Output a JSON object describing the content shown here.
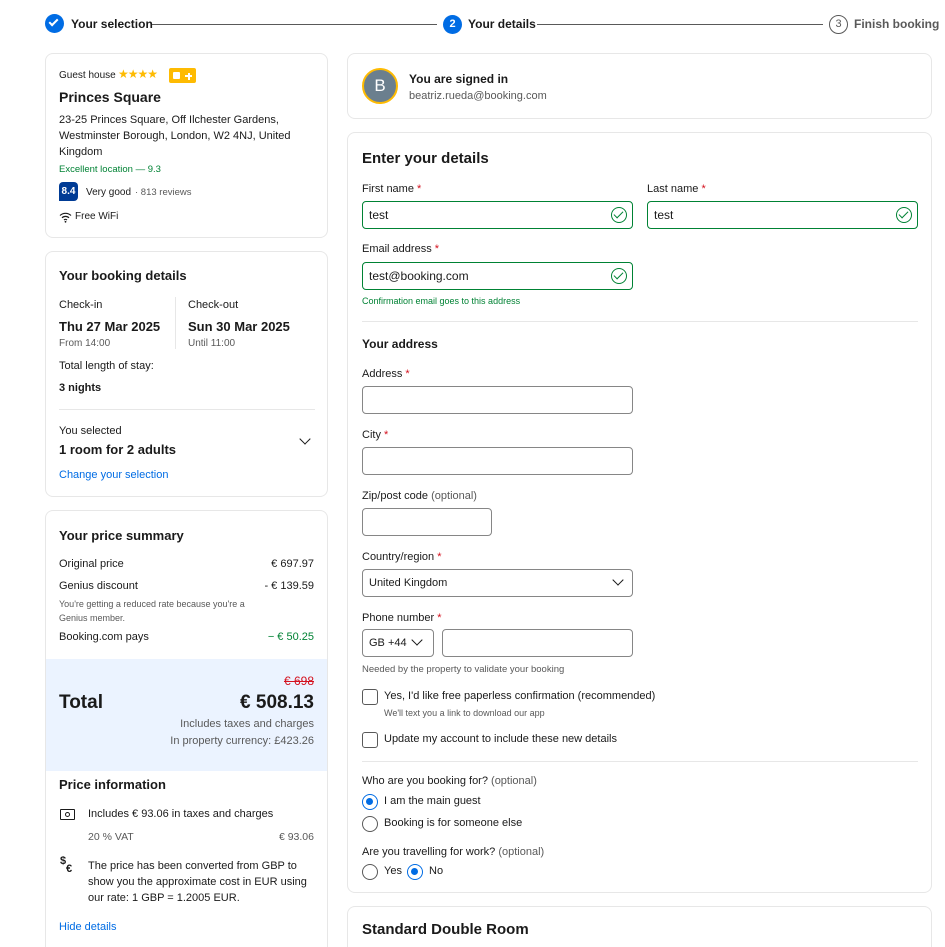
{
  "progress": {
    "step1": "Your selection",
    "step2_num": "2",
    "step2": "Your details",
    "step3_num": "3",
    "step3": "Finish booking"
  },
  "property": {
    "type": "Guest house",
    "stars": "★★★★",
    "name": "Princes Square",
    "address": "23-25 Princes Square, Off Ilchester Gardens, Westminster Borough, London, W2 4NJ, United Kingdom",
    "location": "Excellent location — 9.3",
    "score": "8.4",
    "rating_word": "Very good",
    "reviews": "· 813 reviews",
    "wifi": "Free WiFi"
  },
  "booking": {
    "title": "Your booking details",
    "checkin_label": "Check-in",
    "checkin_date": "Thu 27 Mar 2025",
    "checkin_time": "From 14:00",
    "checkout_label": "Check-out",
    "checkout_date": "Sun 30 Mar 2025",
    "checkout_time": "Until 11:00",
    "length_label": "Total length of stay:",
    "length": "3 nights",
    "selected_label": "You selected",
    "selected": "1 room for 2 adults",
    "change_link": "Change your selection"
  },
  "price": {
    "title": "Your price summary",
    "original_label": "Original price",
    "original": "€ 697.97",
    "genius_label": "Genius discount",
    "genius": "- € 139.59",
    "genius_note": "You're getting a reduced rate because you're a Genius member.",
    "pays_label": "Booking.com pays",
    "pays": "− € 50.25",
    "strike": "€ 698",
    "total_label": "Total",
    "total": "€ 508.13",
    "taxes_note": "Includes taxes and charges",
    "currency_note": "In property currency: £423.26",
    "info_title": "Price information",
    "info_taxes": "Includes € 93.06 in taxes and charges",
    "vat_label": "20 % VAT",
    "vat": "€ 93.06",
    "converted": "The price has been converted from GBP to show you the approximate cost in EUR using our rate: 1 GBP = 1.2005 EUR.",
    "hide_link": "Hide details"
  },
  "signed": {
    "avatar": "B",
    "title": "You are signed in",
    "email": "beatriz.rueda@booking.com"
  },
  "form": {
    "title": "Enter your details",
    "first_label": "First name",
    "first_value": "test",
    "last_label": "Last name",
    "last_value": "test",
    "email_label": "Email address",
    "email_value": "test@booking.com",
    "email_note": "Confirmation email goes to this address",
    "addr_title": "Your address",
    "address_label": "Address",
    "city_label": "City",
    "zip_label": "Zip/post code",
    "zip_opt": "(optional)",
    "country_label": "Country/region",
    "country_value": "United Kingdom",
    "phone_label": "Phone number",
    "phone_code": "GB +44",
    "phone_note": "Needed by the property to validate your booking",
    "paperless": "Yes, I'd like free paperless confirmation (recommended)",
    "paperless_note": "We'll text you a link to download our app",
    "update": "Update my account to include these new details",
    "who_label": "Who are you booking for?",
    "who_opt": "(optional)",
    "who_main": "I am the main guest",
    "who_else": "Booking is for someone else",
    "work_label": "Are you travelling for work?",
    "work_opt": "(optional)",
    "work_yes": "Yes",
    "work_no": "No"
  },
  "room": {
    "title": "Standard Double Room"
  },
  "colors": {
    "accent": "#006ce4",
    "green": "#008234",
    "brand_dark": "#003b95",
    "genius_yellow": "#febb02"
  }
}
